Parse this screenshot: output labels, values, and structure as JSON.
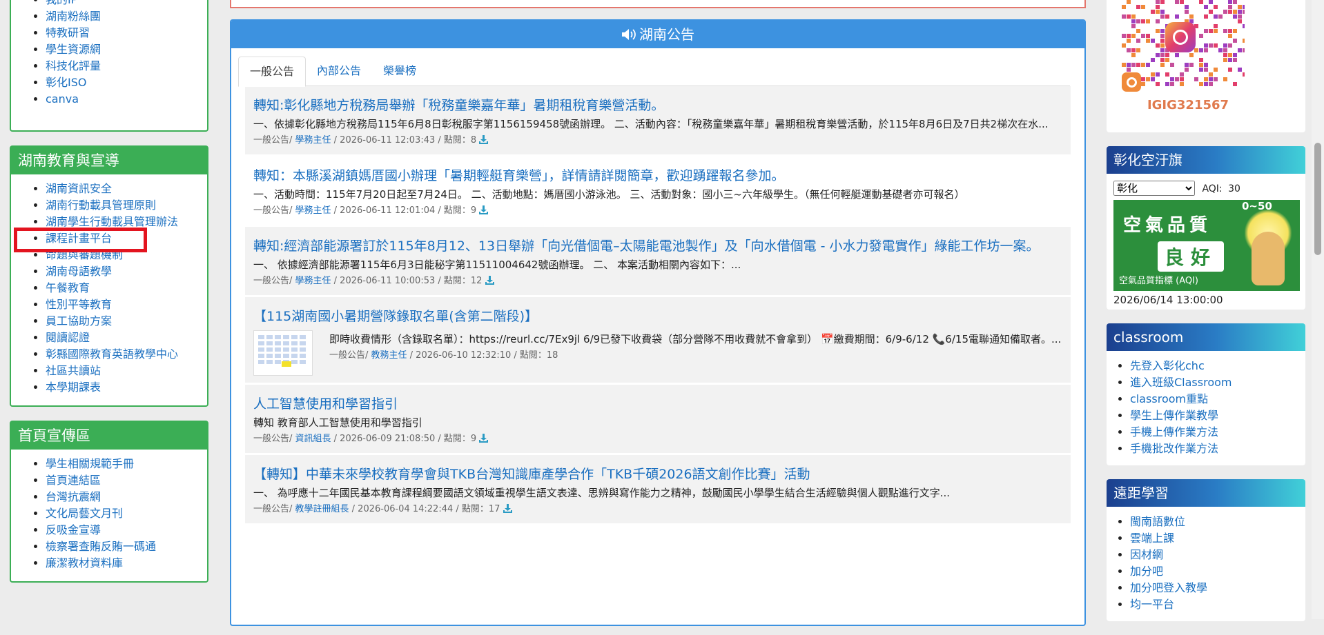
{
  "left": {
    "top_links": [
      "我的IP",
      "湖南粉絲團",
      "特教研習",
      "學生資源網",
      "科技化評量",
      "彰化ISO",
      "canva"
    ],
    "edu": {
      "title": "湖南教育與宣導",
      "items": [
        "湖南資訊安全",
        "湖南行動載具管理原則",
        "湖南學生行動載具管理辦法",
        "課程計畫平台",
        "命題與審題機制",
        "湖南母語教學",
        "午餐教育",
        "性別平等教育",
        "員工協助方案",
        "閱讀認證",
        "彰縣國際教育英語教學中心",
        "社區共讀站",
        "本學期課表"
      ]
    },
    "promo": {
      "title": "首頁宣傳區",
      "items": [
        "學生相關規範手冊",
        "首頁連結區",
        "台灣抗震網",
        "文化局藝文月刊",
        "反吸金宣導",
        "檢察署查賄反賄一碼通",
        "廉潔教材資料庫"
      ]
    }
  },
  "announcements": {
    "title": "湖南公告",
    "tabs": [
      "一般公告",
      "內部公告",
      "榮譽榜"
    ],
    "active_tab": "一般公告",
    "items": [
      {
        "title": "轉知:彰化縣地方稅務局舉辦「稅務童樂嘉年華」暑期租稅育樂營活動。",
        "desc": "一、依據彰化縣地方稅務局115年6月8日彰稅服字第1156159458號函辦理。 二、活動內容：「稅務童樂嘉年華」暑期租稅育樂營活動，於115年8月6日及7日共2梯次在水...",
        "category": "一般公告/ ",
        "author": "學務主任",
        "info": " / 2026-06-11 12:03:43 / 點閱：8 "
      },
      {
        "title": "轉知：本縣溪湖鎮媽厝國小辦理「暑期輕艇育樂營」，詳情請詳閱簡章，歡迎踴躍報名參加。",
        "desc": "一、活動時間：115年7月20日起至7月24日。 二、活動地點：媽厝國小游泳池。 三、活動對象：國小三~六年級學生。（無任何輕艇運動基礎者亦可報名）",
        "category": "一般公告/ ",
        "author": "學務主任",
        "info": " / 2026-06-11 12:01:04 / 點閱：9 "
      },
      {
        "title": "轉知:經濟部能源署訂於115年8月12、13日舉辦「向光借個電–太陽能電池製作」及「向水借個電 - 小水力發電實作」綠能工作坊一案。",
        "desc": "一、 依據經濟部能源署115年6月3日能秘字第11511004642號函辦理。 二、 本案活動相關內容如下：...",
        "category": "一般公告/ ",
        "author": "學務主任",
        "info": " / 2026-06-11 10:00:53 / 點閱：12 "
      },
      {
        "title": "【115湖南國小暑期營隊錄取名單(含第二階段)】",
        "desc": "即時收費情形（含錄取名單）：https://reurl.cc/7Ex9jl 6/9已發下收費袋（部分營隊不用收費就不會拿到） 📅繳費期間：6/9-6/12 📞6/15電聯通知備取者。...",
        "category": "一般公告/ ",
        "author": "教務主任",
        "info": " / 2026-06-10 12:32:10 / 點閱：18"
      },
      {
        "title": "人工智慧使用和學習指引",
        "desc": "轉知 教育部人工智慧使用和學習指引",
        "category": "一般公告/ ",
        "author": "資訊組長",
        "info": " / 2026-06-09 21:08:50 / 點閱：9 "
      },
      {
        "title": "【轉知】中華未來學校教育學會與TKB台灣知識庫產學合作「TKB千碩2026語文創作比賽」活動",
        "desc": "一、 為呼應十二年國民基本教育課程綱要國語文領域重視學生語文表達、思辨與寫作能力之精神，鼓勵國民小學學生結合生活經驗與個人觀點進行文字...",
        "category": "一般公告/ ",
        "author": "教學註冊組長",
        "info": " / 2026-06-04 14:22:44 / 點閱：17 "
      }
    ]
  },
  "right": {
    "ig_id": "IGIG321567",
    "aqi": {
      "title": "彰化空汙旗",
      "selected": "彰化",
      "label": "AQI:",
      "value": "30",
      "img_quality": "空氣品質",
      "img_status": "良好",
      "img_caption": "空氣品質指標 (AQI)",
      "img_range": "0~50",
      "time": "2026/06/14 13:00:00"
    },
    "classroom": {
      "title": "classroom",
      "items": [
        "先登入彰化chc",
        "進入班級Classroom",
        "classroom重點",
        "學生上傳作業教學",
        "手機上傳作業方法",
        "手機批改作業方法"
      ]
    },
    "remote": {
      "title": "遠距學習",
      "items": [
        "閩南語數位",
        "雲端上課",
        "因材網",
        "加分吧",
        "加分吧登入教學",
        "均一平台"
      ]
    }
  }
}
